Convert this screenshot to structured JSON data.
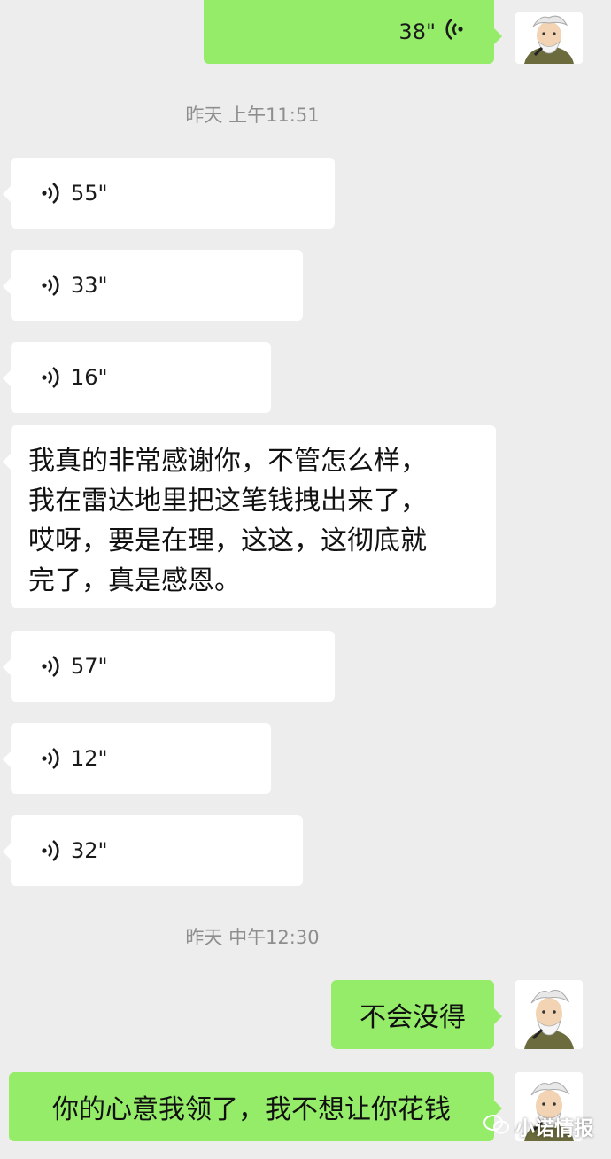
{
  "colors": {
    "background": "#ededed",
    "incoming_bubble": "#ffffff",
    "outgoing_bubble": "#95ec69",
    "timestamp_text": "#8e8e8e"
  },
  "messages": {
    "out_voice_top": {
      "duration": "38\""
    },
    "timestamp_1": "昨天 上午11:51",
    "in_voice_1": {
      "duration": "55\""
    },
    "in_voice_2": {
      "duration": "33\""
    },
    "in_voice_3": {
      "duration": "16\""
    },
    "in_text_1": "我真的非常感谢你，不管怎么样，\n我在雷达地里把这笔钱拽出来了，\n哎呀，要是在理，这这，这彻底就\n完了，真是感恩。",
    "in_voice_4": {
      "duration": "57\""
    },
    "in_voice_5": {
      "duration": "12\""
    },
    "in_voice_6": {
      "duration": "32\""
    },
    "timestamp_2": "昨天 中午12:30",
    "out_text_1": "不会没得",
    "out_text_2": "你的心意我领了，我不想让你花钱"
  },
  "icons": {
    "voice_in": "voice-wave-icon",
    "voice_out": "voice-wave-icon",
    "avatar": "user-avatar"
  },
  "watermark": {
    "text": "小诺情报"
  }
}
